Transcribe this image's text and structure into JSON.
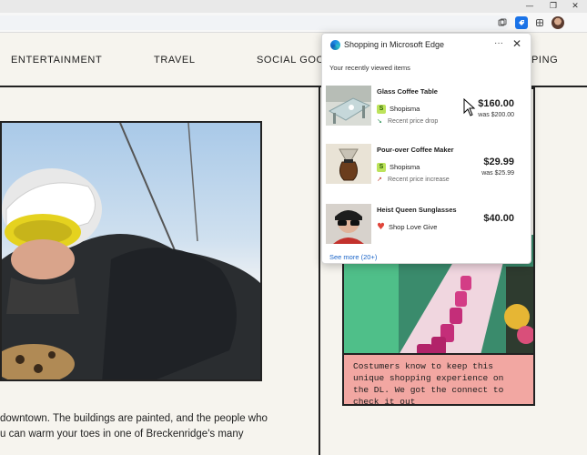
{
  "browser": {
    "window_controls": [
      "—",
      "❐",
      "✕"
    ],
    "toolbar_icons": [
      "collections-icon",
      "shopping-icon",
      "extensions-icon",
      "profile-avatar"
    ]
  },
  "nav": {
    "items": [
      "ENTERTAINMENT",
      "TRAVEL",
      "SOCIAL GOOD",
      "PING"
    ]
  },
  "article": {
    "body_line_1": "downtown. The buildings are painted, and the people who",
    "body_line_2": "u can warm your toes in one of Breckenridge's many"
  },
  "promo": {
    "text": "Costumers know to keep this unique shopping experience on the DL. We got the connect to check it out"
  },
  "panel": {
    "title": "Shopping in Microsoft Edge",
    "more": "···",
    "close": "✕",
    "subtitle": "Your recently viewed items",
    "items": [
      {
        "title": "Glass Coffee Table",
        "seller": "Shopisma",
        "note": "Recent price drop",
        "note_icon": "↘",
        "price": "$160.00",
        "was": "was $200.00"
      },
      {
        "title": "Pour-over Coffee Maker",
        "seller": "Shopisma",
        "note": "Recent price increase",
        "note_icon": "↗",
        "price": "$29.99",
        "was": "was $25.99"
      },
      {
        "title": "Heist Queen Sunglasses",
        "seller": "Shop Love Give",
        "note": "",
        "note_icon": "",
        "price": "$40.00",
        "was": ""
      }
    ],
    "see_more": "See more (20+)",
    "seller_badge": "S",
    "heart_symbol": "♥"
  },
  "colors": {
    "accent": "#1a73e8",
    "link": "#1a64c8",
    "promo_bg": "#f2a7a2",
    "seller_badge": "#bde35b"
  }
}
